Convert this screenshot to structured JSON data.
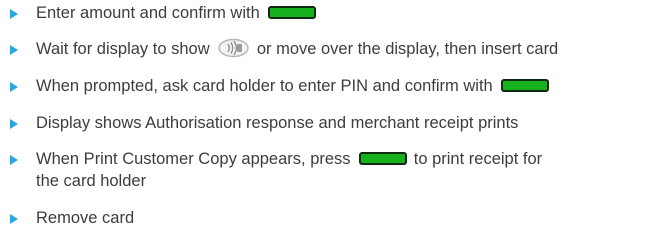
{
  "steps": [
    {
      "parts": [
        "Enter amount and confirm with",
        "[green-key]"
      ]
    },
    {
      "parts": [
        "Wait for display to show",
        "[contactless-icon]",
        "or move over the display, then insert card"
      ]
    },
    {
      "parts": [
        "When prompted, ask card holder to enter PIN and confirm with",
        "[green-key]"
      ]
    },
    {
      "parts": [
        "Display shows Authorisation response and merchant receipt prints"
      ]
    },
    {
      "parts": [
        "When Print Customer Copy appears, press",
        "[green-key]",
        "to print receipt for",
        "the card holder"
      ]
    },
    {
      "parts": [
        "Remove card"
      ]
    }
  ],
  "colors": {
    "bullet": "#29a8e0",
    "key": "#16b21d",
    "text": "#3d3d3d"
  },
  "icons": {
    "key": "green-confirm-key-icon",
    "contactless": "contactless-reader-icon"
  }
}
